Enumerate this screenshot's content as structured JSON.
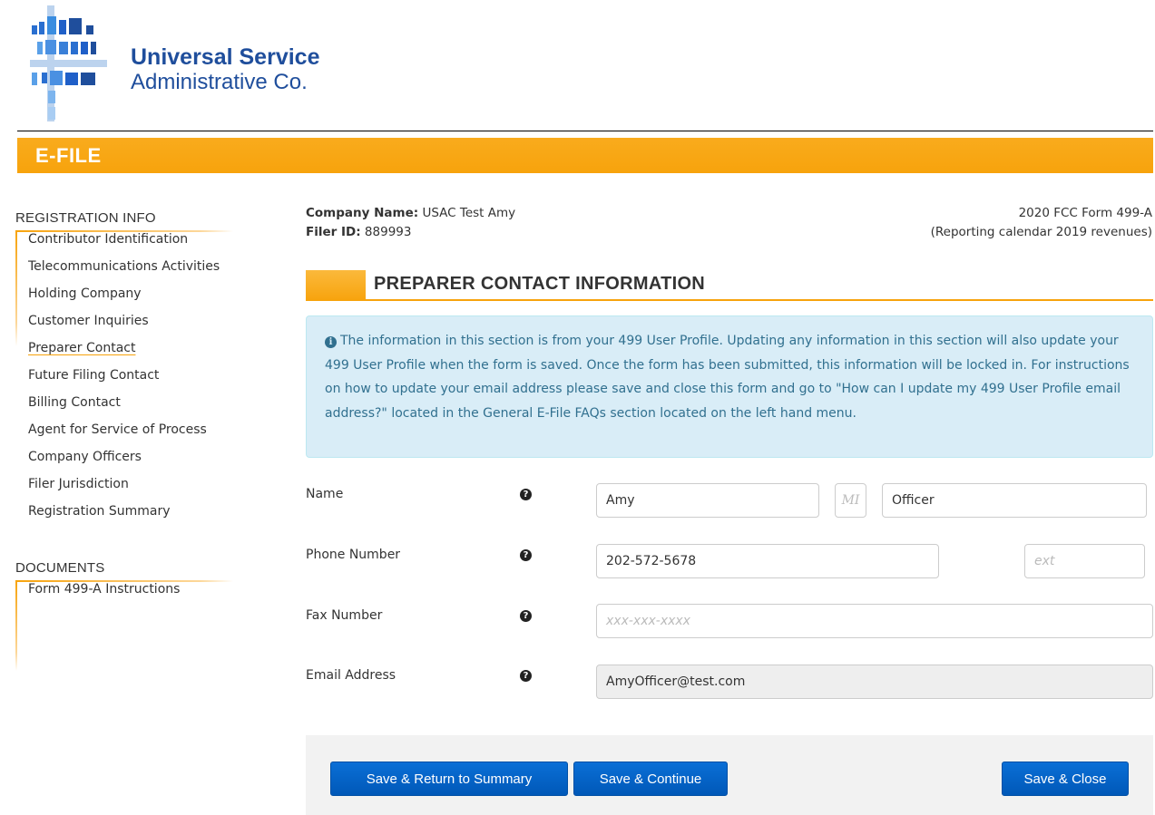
{
  "header": {
    "logo_line1": "Universal Service",
    "logo_line2": "Administrative Co.",
    "banner_title": "E-FILE"
  },
  "sidebar": {
    "registration_heading": "REGISTRATION INFO",
    "registration_items": [
      {
        "label": "Contributor Identification"
      },
      {
        "label": "Telecommunications Activities"
      },
      {
        "label": "Holding Company"
      },
      {
        "label": "Customer Inquiries"
      },
      {
        "label": "Preparer Contact"
      },
      {
        "label": "Future Filing Contact"
      },
      {
        "label": "Billing Contact"
      },
      {
        "label": "Agent for Service of Process"
      },
      {
        "label": "Company Officers"
      },
      {
        "label": "Filer Jurisdiction"
      },
      {
        "label": "Registration Summary"
      }
    ],
    "active_item": "Preparer Contact",
    "documents_heading": "DOCUMENTS",
    "documents_items": [
      {
        "label": "Form 499-A Instructions"
      }
    ]
  },
  "meta": {
    "company_label": "Company Name:",
    "company_value": "USAC Test Amy",
    "filer_label": "Filer ID:",
    "filer_value": "889993",
    "form_title": "2020 FCC Form 499-A",
    "form_subtitle": "(Reporting calendar 2019 revenues)"
  },
  "section": {
    "title": "PREPARER CONTACT INFORMATION",
    "info_text": "The information in this section is from your 499 User Profile. Updating any information in this section will also update your 499 User Profile when the form is saved. Once the form has been submitted, this information will be locked in. For instructions on how to update your email address please save and close this form and go to \"How can I update my 499 User Profile email address?\" located in the General E-File FAQs section located on the left hand menu."
  },
  "form": {
    "name_label": "Name",
    "first_name_value": "Amy",
    "mi_placeholder": "MI",
    "last_name_value": "Officer",
    "phone_label": "Phone Number",
    "phone_value": "202-572-5678",
    "ext_placeholder": "ext",
    "fax_label": "Fax Number",
    "fax_placeholder": "xxx-xxx-xxxx",
    "email_label": "Email Address",
    "email_value": "AmyOfficer@test.com"
  },
  "footer": {
    "save_return_label": "Save & Return to Summary",
    "save_continue_label": "Save & Continue",
    "save_close_label": "Save & Close"
  },
  "colors": {
    "accent_orange": "#f7a30c",
    "brand_blue": "#1f4e9c",
    "button_blue": "#0a6fd6",
    "info_bg": "#d9edf7"
  }
}
